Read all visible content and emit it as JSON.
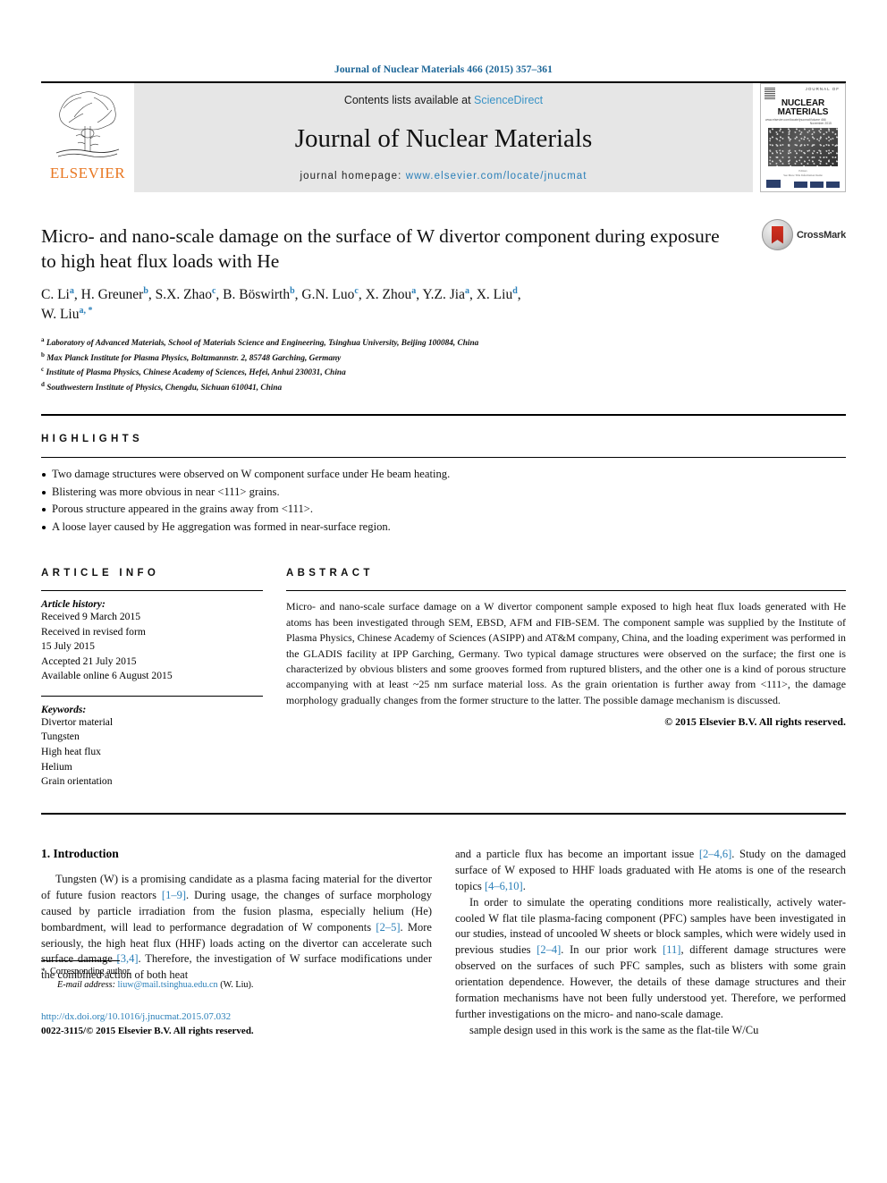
{
  "running_head": "Journal of Nuclear Materials 466 (2015) 357–361",
  "masthead": {
    "contents_prefix": "Contents lists available at ",
    "sciencedirect": "ScienceDirect",
    "journal_title": "Journal of Nuclear Materials",
    "homepage_label": "journal homepage: ",
    "homepage_url": "www.elsevier.com/locate/jnucmat",
    "publisher": "ELSEVIER",
    "cover": {
      "title": "NUCLEAR MATERIALS",
      "overline": "JOURNAL OF",
      "left_note": "www.elsevier.com/locate/jnucmat",
      "right_note": "Volume 466  November 2015",
      "foot_note_1": "Editors",
      "foot_note_2": "See More Title Information Inside"
    }
  },
  "article": {
    "title": "Micro- and nano-scale damage on the surface of W divertor component during exposure to high heat flux loads with He",
    "authors_line1": "C. Li a, H. Greuner b, S.X. Zhao c, B. Böswirth b, G.N. Luo c, X. Zhou a, Y.Z. Jia a, X. Liu d,",
    "authors_line2": "W. Liu a, *",
    "authors": [
      {
        "name": "C. Li",
        "marks": "a"
      },
      {
        "name": "H. Greuner",
        "marks": "b"
      },
      {
        "name": "S.X. Zhao",
        "marks": "c"
      },
      {
        "name": "B. Böswirth",
        "marks": "b"
      },
      {
        "name": "G.N. Luo",
        "marks": "c"
      },
      {
        "name": "X. Zhou",
        "marks": "a"
      },
      {
        "name": "Y.Z. Jia",
        "marks": "a"
      },
      {
        "name": "X. Liu",
        "marks": "d"
      },
      {
        "name": "W. Liu",
        "marks": "a, *"
      }
    ],
    "affiliations": [
      {
        "mark": "a",
        "text": "Laboratory of Advanced Materials, School of Materials Science and Engineering, Tsinghua University, Beijing 100084, China"
      },
      {
        "mark": "b",
        "text": "Max Planck Institute for Plasma Physics, Boltzmannstr. 2, 85748 Garching, Germany"
      },
      {
        "mark": "c",
        "text": "Institute of Plasma Physics, Chinese Academy of Sciences, Hefei, Anhui 230031, China"
      },
      {
        "mark": "d",
        "text": "Southwestern Institute of Physics, Chengdu, Sichuan 610041, China"
      }
    ],
    "crossmark_label": "CrossMark"
  },
  "highlights": {
    "heading": "HIGHLIGHTS",
    "items": [
      "Two damage structures were observed on W component surface under He beam heating.",
      "Blistering was more obvious in near <111> grains.",
      "Porous structure appeared in the grains away from <111>.",
      "A loose layer caused by He aggregation was formed in near-surface region."
    ]
  },
  "article_info": {
    "heading": "ARTICLE INFO",
    "history_label": "Article history:",
    "history": [
      "Received 9 March 2015",
      "Received in revised form",
      "15 July 2015",
      "Accepted 21 July 2015",
      "Available online 6 August 2015"
    ],
    "keywords_label": "Keywords:",
    "keywords": [
      "Divertor material",
      "Tungsten",
      "High heat flux",
      "Helium",
      "Grain orientation"
    ]
  },
  "abstract": {
    "heading": "ABSTRACT",
    "text": "Micro- and nano-scale surface damage on a W divertor component sample exposed to high heat flux loads generated with He atoms has been investigated through SEM, EBSD, AFM and FIB-SEM. The component sample was supplied by the Institute of Plasma Physics, Chinese Academy of Sciences (ASIPP) and AT&M company, China, and the loading experiment was performed in the GLADIS facility at IPP Garching, Germany. Two typical damage structures were observed on the surface; the first one is characterized by obvious blisters and some grooves formed from ruptured blisters, and the other one is a kind of porous structure accompanying with at least ~25 nm surface material loss. As the grain orientation is further away from <111>, the damage morphology gradually changes from the former structure to the latter. The possible damage mechanism is discussed.",
    "copyright": "© 2015 Elsevier B.V. All rights reserved."
  },
  "body": {
    "section_title": "1.  Introduction",
    "left_p1_a": "Tungsten (W) is a promising candidate as a plasma facing material for the divertor of future fusion reactors ",
    "left_p1_r1": "[1–9]",
    "left_p1_b": ". During usage, the changes of surface morphology caused by particle irradiation from the fusion plasma, especially helium (He) bombardment, will lead to performance degradation of W components ",
    "left_p1_r2": "[2–5]",
    "left_p1_c": ". More seriously, the high heat flux (HHF) loads acting on the divertor can accelerate such surface damage ",
    "left_p1_r3": "[3,4]",
    "left_p1_d": ". Therefore, the investigation of W surface modifications under the combined action of both heat",
    "right_p1_a": "and a particle flux has become an important issue ",
    "right_p1_r1": "[2–4,6]",
    "right_p1_b": ". Study on the damaged surface of W exposed to HHF loads graduated with He atoms is one of the research topics ",
    "right_p1_r2": "[4–6,10]",
    "right_p1_c": ".",
    "right_p2_a": "In order to simulate the operating conditions more realistically, actively water-cooled W flat tile plasma-facing component (PFC) samples have been investigated in our studies, instead of uncooled W sheets or block samples, which were widely used in previous studies ",
    "right_p2_r1": "[2–4]",
    "right_p2_b": ". In our prior work ",
    "right_p2_r2": "[11]",
    "right_p2_c": ", different damage structures were observed on the surfaces of such PFC samples, such as blisters with some grain orientation dependence. However, the details of these damage structures and their formation mechanisms have not been fully understood yet. Therefore, we performed further investigations on the micro- and nano-scale damage.",
    "right_p3": "sample design used in this work is the same as the flat-tile W/Cu"
  },
  "footer": {
    "corresponding": "Corresponding author.",
    "email_label": "E-mail address:",
    "email": "liuw@mail.tsinghua.edu.cn",
    "email_suffix": "(W. Liu).",
    "doi": "http://dx.doi.org/10.1016/j.jnucmat.2015.07.032",
    "issn": "0022-3115/© 2015 Elsevier B.V. All rights reserved."
  },
  "colors": {
    "link": "#2a7fb8",
    "elsevier_orange": "#e87722",
    "masthead_bg": "#e6e6e6"
  }
}
